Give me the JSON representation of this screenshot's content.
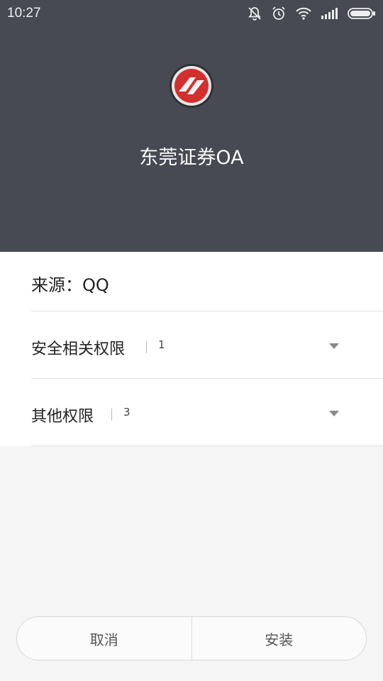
{
  "status_bar": {
    "time": "10:27",
    "icons": [
      "silent-bell-icon",
      "alarm-icon",
      "wifi-icon",
      "signal-icon",
      "battery-icon"
    ]
  },
  "app": {
    "name": "东莞证券OA",
    "icon": "app-logo-icon"
  },
  "source": {
    "label": "来源：QQ"
  },
  "permissions": [
    {
      "label": "安全相关权限",
      "count": "1",
      "icon": "chevron-down-icon"
    },
    {
      "label": "其他权限",
      "count": "3",
      "icon": "chevron-down-icon"
    }
  ],
  "buttons": {
    "cancel": "取消",
    "install": "安装"
  },
  "colors": {
    "header_bg": "#474a53",
    "panel_bg": "#ffffff",
    "page_bg": "#f5f5f5",
    "logo_red": "#d32f2f"
  }
}
